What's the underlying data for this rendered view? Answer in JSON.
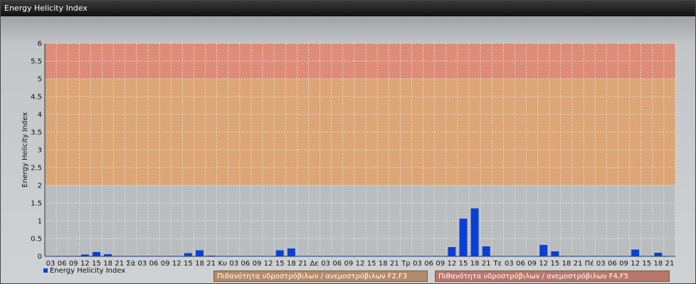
{
  "window": {
    "title": "Energy Helicity Index"
  },
  "chart_data": {
    "type": "bar",
    "title": "",
    "xlabel": "",
    "ylabel": "Energy Helicity Index",
    "ylim": [
      0,
      6
    ],
    "yticks": [
      "0",
      "0.5",
      "1",
      "1.5",
      "2",
      "2.5",
      "3",
      "3.5",
      "4",
      "4.5",
      "5",
      "5.5",
      "6"
    ],
    "grid": true,
    "legend_position": "bottom-left",
    "categories": [
      "03",
      "06",
      "09",
      "12",
      "15",
      "18",
      "21",
      "Σά",
      "03",
      "06",
      "09",
      "12",
      "15",
      "18",
      "21",
      "Κυ",
      "03",
      "06",
      "09",
      "12",
      "15",
      "18",
      "21",
      "Δε",
      "03",
      "06",
      "09",
      "12",
      "15",
      "18",
      "21",
      "Τρ",
      "03",
      "06",
      "09",
      "12",
      "15",
      "18",
      "21",
      "Τε",
      "03",
      "06",
      "09",
      "12",
      "15",
      "18",
      "21",
      "Πέ",
      "03",
      "06",
      "09",
      "12",
      "15",
      "18",
      "21"
    ],
    "series": [
      {
        "name": "Energy Helicity Index",
        "color": "#0a3fd6",
        "values": [
          0.01,
          0.01,
          0.01,
          0.05,
          0.12,
          0.06,
          0.01,
          0.01,
          0.01,
          0.01,
          0.01,
          0.01,
          0.09,
          0.17,
          0.02,
          0.01,
          0.01,
          0.01,
          0.01,
          0.01,
          0.17,
          0.22,
          0.01,
          0.01,
          0.01,
          0.01,
          0.01,
          0.01,
          0.01,
          0.01,
          0.01,
          0.01,
          0.01,
          0.01,
          0.01,
          0.26,
          1.06,
          1.35,
          0.28,
          0.01,
          0.01,
          0.01,
          0.01,
          0.32,
          0.14,
          0.01,
          0.01,
          0.01,
          0.01,
          0.01,
          0.01,
          0.19,
          0.01,
          0.1,
          0.01
        ]
      }
    ],
    "bands": [
      {
        "from": 2,
        "to": 5,
        "label": "Πιθανότητα υδροστρόβιλων / ανεμοστρόβιλων F2,F3",
        "color": "#e0a167"
      },
      {
        "from": 5,
        "to": 6,
        "label": "Πιθανότητα υδροστρόβιλων / ανεμοστρόβιλων F4,F5",
        "color": "#e3846b"
      }
    ]
  }
}
